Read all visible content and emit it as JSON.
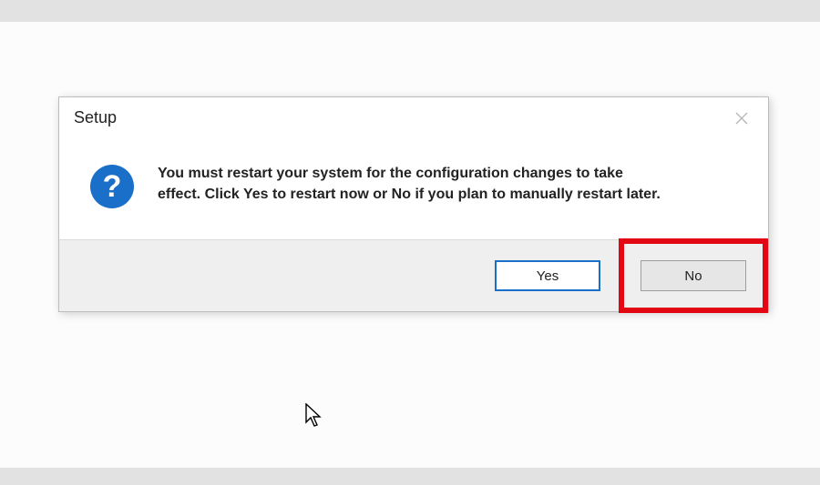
{
  "dialog": {
    "title": "Setup",
    "message": "You must restart your system for the configuration changes to take effect. Click Yes to restart now or No if you plan to manually restart later.",
    "icon": "question-mark",
    "icon_glyph": "?",
    "buttons": {
      "yes_label": "Yes",
      "no_label": "No"
    }
  },
  "highlight": "no-button",
  "colors": {
    "accent": "#1a6fc9",
    "highlight_border": "#e30613"
  }
}
